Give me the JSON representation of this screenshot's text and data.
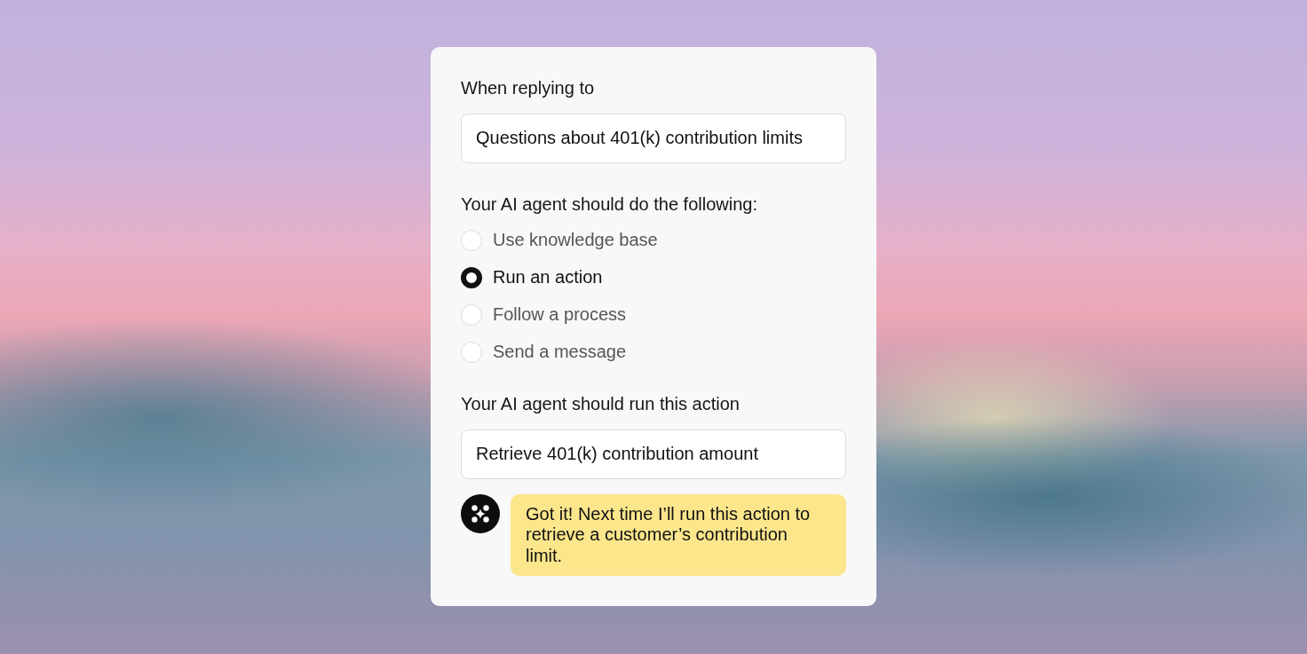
{
  "card": {
    "trigger": {
      "label": "When replying to",
      "value": "Questions about 401(k) contribution limits"
    },
    "behavior": {
      "label": "Your AI agent should do the following:",
      "options": [
        {
          "label": "Use knowledge base",
          "selected": false
        },
        {
          "label": "Run an action",
          "selected": true
        },
        {
          "label": "Follow a process",
          "selected": false
        },
        {
          "label": "Send a message",
          "selected": false
        }
      ]
    },
    "action": {
      "label": "Your AI agent should run this action",
      "value": "Retrieve 401(k) contribution amount"
    },
    "reply": {
      "message": "Got it! Next time I’ll run this action to retrieve a customer’s contribution limit."
    }
  }
}
